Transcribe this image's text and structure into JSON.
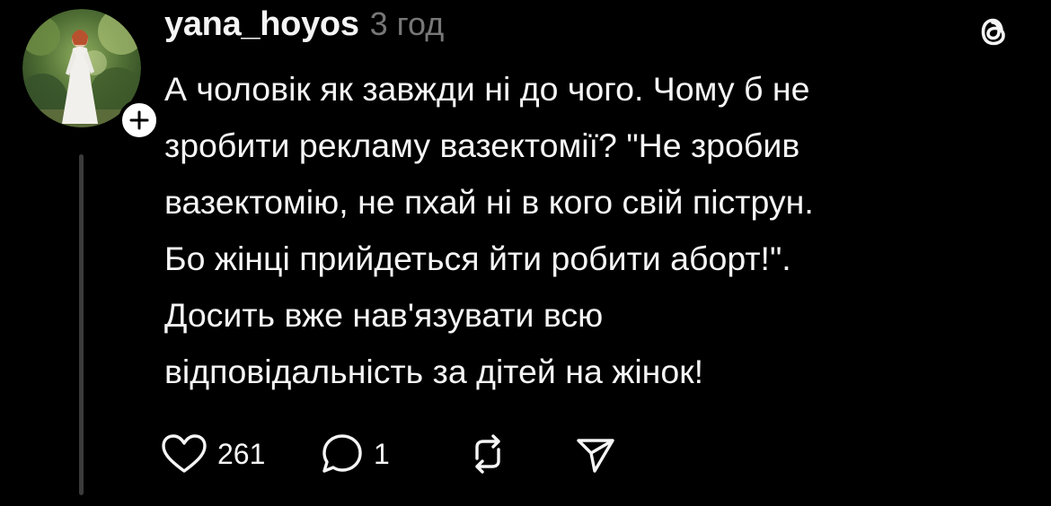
{
  "post": {
    "author": {
      "username": "yana_hoyos",
      "avatar_icon": "profile-photo"
    },
    "timestamp": "3 год",
    "text": "А чоловік як завжди ні до чого. Чому б не\nзробити рекламу вазектомії? \"Не зробив\nвазектомію, не пхай ні в кого свій піструн.\nБо жінці прийдеться йти робити аборт!\".\nДосить вже нав'язувати всю\nвідповідальність за дітей на жінок!",
    "follow_icon": "plus-icon",
    "app_icon": "threads-logo-icon",
    "actions": {
      "like": {
        "icon": "heart-icon",
        "count": "261"
      },
      "reply": {
        "icon": "comment-icon",
        "count": "1"
      },
      "repost": {
        "icon": "repost-icon"
      },
      "share": {
        "icon": "send-icon"
      }
    }
  },
  "colors": {
    "background": "#000000",
    "text_primary": "#f5f5f5",
    "text_secondary": "#777777",
    "thread_line": "#3a3a3a"
  }
}
